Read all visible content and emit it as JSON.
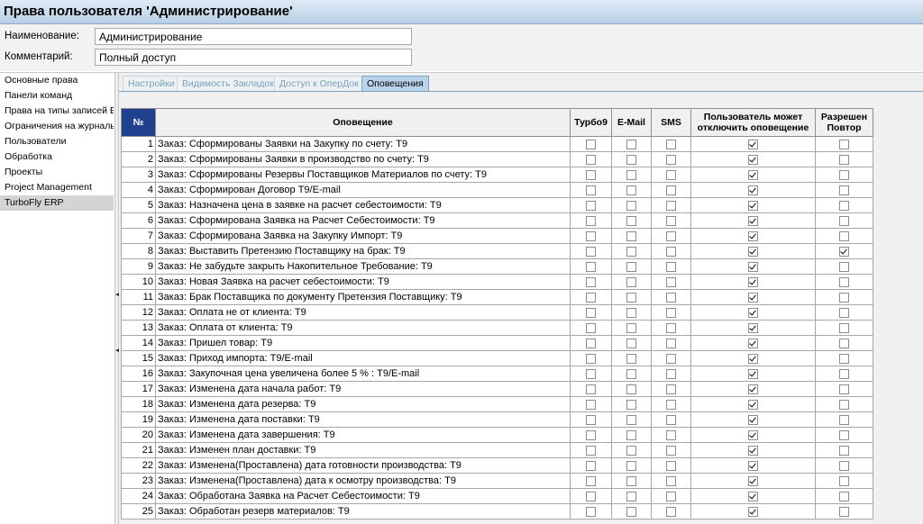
{
  "window": {
    "title": "Права пользователя 'Администрирование'"
  },
  "form": {
    "name_label": "Наименование:",
    "name_value": "Администрирование",
    "comment_label": "Комментарий:",
    "comment_value": "Полный доступ"
  },
  "sidebar": {
    "items": [
      {
        "label": "Основные права",
        "selected": false
      },
      {
        "label": "Панели команд",
        "selected": false
      },
      {
        "label": "Права на типы записей Е",
        "selected": false
      },
      {
        "label": "Ограничения на журналь",
        "selected": false
      },
      {
        "label": "Пользователи",
        "selected": false
      },
      {
        "label": "Обработка",
        "selected": false
      },
      {
        "label": "Проекты",
        "selected": false
      },
      {
        "label": "Project Management",
        "selected": false
      },
      {
        "label": "TurboFly ERP",
        "selected": true
      }
    ]
  },
  "tabs": [
    {
      "label": "Настройки",
      "active": false
    },
    {
      "label": "Видимость Закладок",
      "active": false
    },
    {
      "label": "Доступ к ОперДок",
      "active": false
    },
    {
      "label": "Оповещения",
      "active": true
    }
  ],
  "table": {
    "headers": {
      "num": "№",
      "alert": "Оповещение",
      "turbo": "Турбо9",
      "email": "E-Mail",
      "sms": "SMS",
      "user_can_disable": "Пользователь может отключить оповещение",
      "allow_repeat": "Разрешен Повтор"
    },
    "rows": [
      {
        "n": "1",
        "text": "Заказ: Сформированы Заявки на Закупку по счету: Т9",
        "turbo": false,
        "email": false,
        "sms": false,
        "disable": true,
        "repeat": false
      },
      {
        "n": "2",
        "text": "Заказ: Сформированы Заявки в производство по счету: Т9",
        "turbo": false,
        "email": false,
        "sms": false,
        "disable": true,
        "repeat": false
      },
      {
        "n": "3",
        "text": "Заказ: Сформированы Резервы Поставщиков Материалов по счету: Т9",
        "turbo": false,
        "email": false,
        "sms": false,
        "disable": true,
        "repeat": false
      },
      {
        "n": "4",
        "text": "Заказ: Сформирован Договор Т9/E-mail",
        "turbo": false,
        "email": false,
        "sms": false,
        "disable": true,
        "repeat": false
      },
      {
        "n": "5",
        "text": "Заказ: Назначена цена в заявке на расчет себестоимости: Т9",
        "turbo": false,
        "email": false,
        "sms": false,
        "disable": true,
        "repeat": false
      },
      {
        "n": "6",
        "text": "Заказ: Сформирована Заявка на Расчет Себестоимости: Т9",
        "turbo": false,
        "email": false,
        "sms": false,
        "disable": true,
        "repeat": false
      },
      {
        "n": "7",
        "text": "Заказ: Сформирована Заявка на Закупку Импорт: Т9",
        "turbo": false,
        "email": false,
        "sms": false,
        "disable": true,
        "repeat": false
      },
      {
        "n": "8",
        "text": "Заказ: Выставить Претензию Поставщику на брак: Т9",
        "turbo": false,
        "email": false,
        "sms": false,
        "disable": true,
        "repeat": true
      },
      {
        "n": "9",
        "text": "Заказ: Не забудьте закрыть Накопительное Требование: Т9",
        "turbo": false,
        "email": false,
        "sms": false,
        "disable": true,
        "repeat": false
      },
      {
        "n": "10",
        "text": "Заказ: Новая Заявка на расчет себестоимости: Т9",
        "turbo": false,
        "email": false,
        "sms": false,
        "disable": true,
        "repeat": false
      },
      {
        "n": "11",
        "text": "Заказ: Брак Поставщика по документу Претензия Поставщику: Т9",
        "turbo": false,
        "email": false,
        "sms": false,
        "disable": true,
        "repeat": false
      },
      {
        "n": "12",
        "text": "Заказ: Оплата не от клиента: Т9",
        "turbo": false,
        "email": false,
        "sms": false,
        "disable": true,
        "repeat": false
      },
      {
        "n": "13",
        "text": "Заказ: Оплата от клиента: Т9",
        "turbo": false,
        "email": false,
        "sms": false,
        "disable": true,
        "repeat": false
      },
      {
        "n": "14",
        "text": "Заказ: Пришел товар: Т9",
        "turbo": false,
        "email": false,
        "sms": false,
        "disable": true,
        "repeat": false
      },
      {
        "n": "15",
        "text": "Заказ: Приход импорта: Т9/E-mail",
        "turbo": false,
        "email": false,
        "sms": false,
        "disable": true,
        "repeat": false
      },
      {
        "n": "16",
        "text": "Заказ: Закупочная цена увеличена более 5 % : Т9/E-mail",
        "turbo": false,
        "email": false,
        "sms": false,
        "disable": true,
        "repeat": false
      },
      {
        "n": "17",
        "text": "Заказ: Изменена дата начала работ: Т9",
        "turbo": false,
        "email": false,
        "sms": false,
        "disable": true,
        "repeat": false
      },
      {
        "n": "18",
        "text": "Заказ: Изменена дата резерва: Т9",
        "turbo": false,
        "email": false,
        "sms": false,
        "disable": true,
        "repeat": false
      },
      {
        "n": "19",
        "text": "Заказ: Изменена дата поставки: Т9",
        "turbo": false,
        "email": false,
        "sms": false,
        "disable": true,
        "repeat": false
      },
      {
        "n": "20",
        "text": "Заказ: Изменена дата завершения: Т9",
        "turbo": false,
        "email": false,
        "sms": false,
        "disable": true,
        "repeat": false
      },
      {
        "n": "21",
        "text": "Заказ: Изменен план доставки: Т9",
        "turbo": false,
        "email": false,
        "sms": false,
        "disable": true,
        "repeat": false
      },
      {
        "n": "22",
        "text": "Заказ: Изменена(Проставлена) дата готовности производства: Т9",
        "turbo": false,
        "email": false,
        "sms": false,
        "disable": true,
        "repeat": false
      },
      {
        "n": "23",
        "text": "Заказ: Изменена(Проставлена) дата к осмотру производства: Т9",
        "turbo": false,
        "email": false,
        "sms": false,
        "disable": true,
        "repeat": false
      },
      {
        "n": "24",
        "text": "Заказ: Обработана Заявка на Расчет Себестоимости: Т9",
        "turbo": false,
        "email": false,
        "sms": false,
        "disable": true,
        "repeat": false
      },
      {
        "n": "25",
        "text": "Заказ: Обработан резерв материалов: Т9",
        "turbo": false,
        "email": false,
        "sms": false,
        "disable": true,
        "repeat": false
      }
    ]
  }
}
